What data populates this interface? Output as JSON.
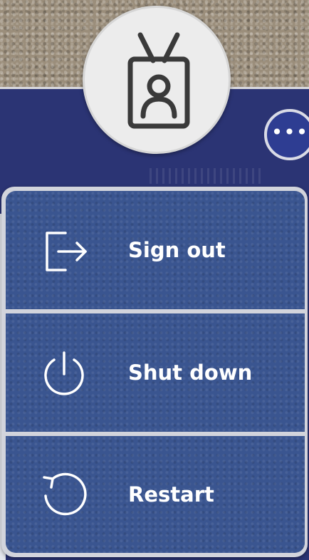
{
  "user": {
    "avatar_icon": "id-badge-icon",
    "more_badge": "•••"
  },
  "menu": {
    "items": [
      {
        "label": "Sign out",
        "icon": "sign-out-icon"
      },
      {
        "label": "Shut down",
        "icon": "power-icon"
      },
      {
        "label": "Restart",
        "icon": "restart-icon"
      }
    ]
  },
  "colors": {
    "panel": "#2b3474",
    "menu_item": "#3a5590",
    "badge": "#2e3d92",
    "avatar": "#ececec",
    "label": "#ffffff"
  }
}
